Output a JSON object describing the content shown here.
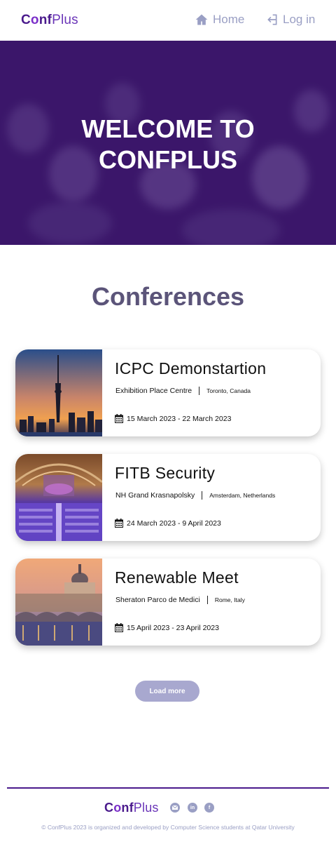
{
  "header": {
    "logo": {
      "c": "C",
      "o": "o",
      "nf": "nf",
      "plus": "Plus"
    },
    "nav": [
      {
        "label": "Home",
        "icon": "home-icon"
      },
      {
        "label": "Log in",
        "icon": "login-icon"
      }
    ]
  },
  "hero": {
    "title_line1": "WELCOME TO",
    "title_line2": "CONFPLUS"
  },
  "conferences": {
    "title": "Conferences",
    "items": [
      {
        "title": "ICPC Demonstartion",
        "venue": "Exhibition Place Centre",
        "city": "Toronto, Canada",
        "dates": "15 March 2023 - 22 March 2023",
        "image": "toronto-skyline-image"
      },
      {
        "title": "FITB Security",
        "venue": "NH Grand Krasnapolsky",
        "city": "Amsterdam, Netherlands",
        "dates": "24 March 2023 - 9 April 2023",
        "image": "conference-hall-image"
      },
      {
        "title": "Renewable Meet",
        "venue": "Sheraton Parco de Medici",
        "city": "Rome, Italy",
        "dates": "15 April 2023 - 23 April 2023",
        "image": "rome-vatican-image"
      }
    ],
    "load_more": "Load more"
  },
  "footer": {
    "logo": {
      "c": "C",
      "o": "o",
      "nf": "nf",
      "plus": "Plus"
    },
    "social": [
      "mail-icon",
      "linkedin-icon",
      "facebook-icon"
    ],
    "copyright": "© ConfPlus 2023 is organized and developed by Computer Science students at Qatar University"
  },
  "colors": {
    "brand_dark": "#4a1a8c",
    "brand_light": "#7b2fc9",
    "nav_gray": "#9a9fc4",
    "hero_overlay": "#3c146e",
    "section_title": "#5b5479",
    "button": "#a8a8cf"
  }
}
